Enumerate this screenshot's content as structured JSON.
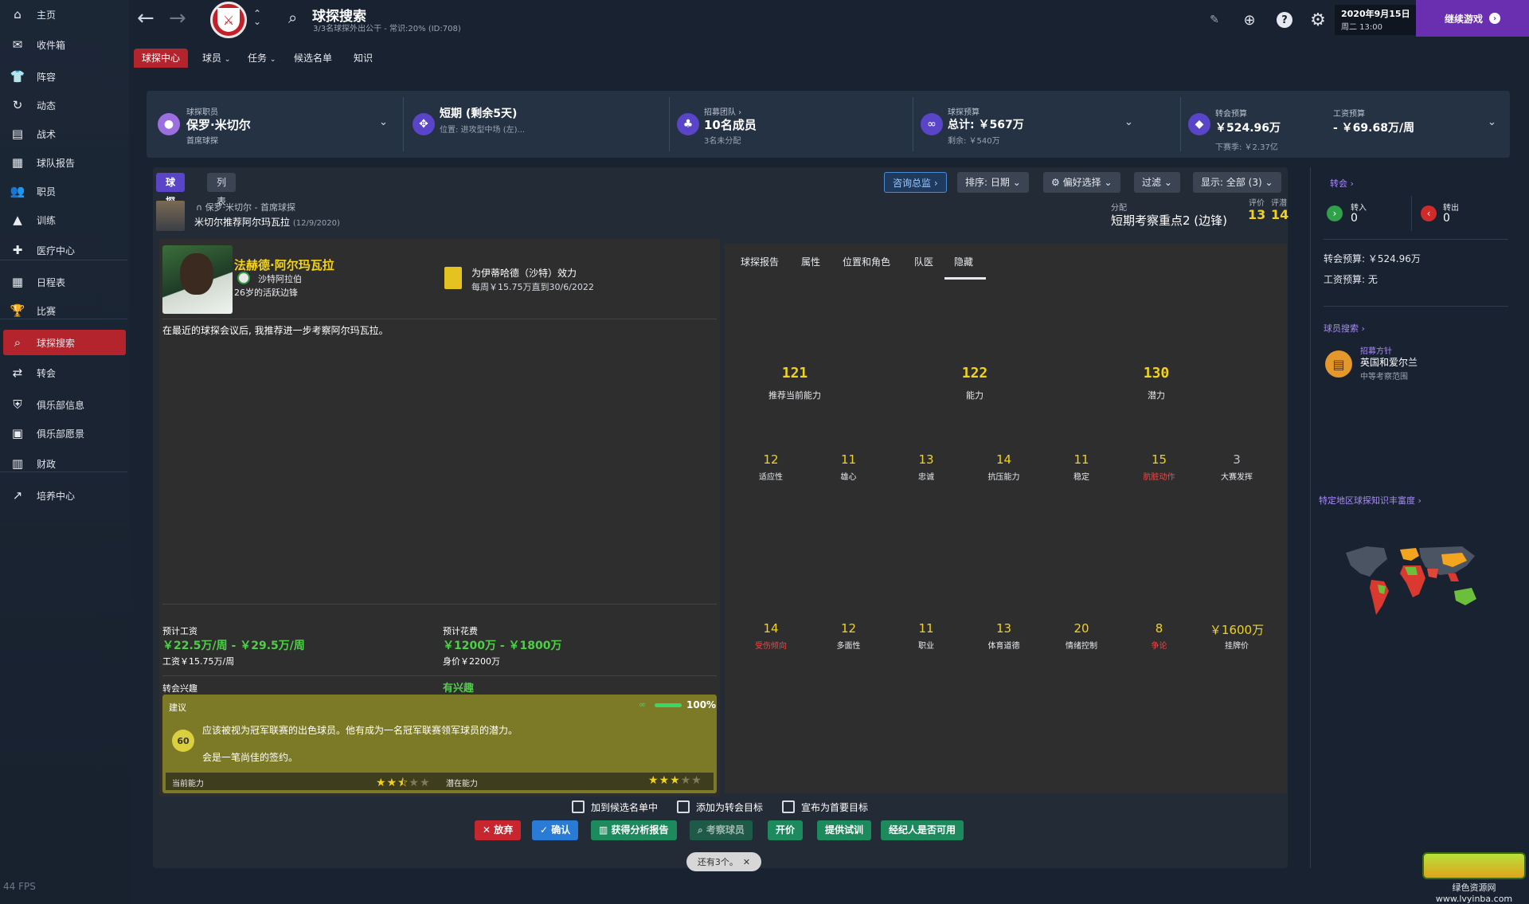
{
  "sidebar": {
    "items": [
      {
        "label": "主页",
        "icon": "home-icon",
        "glyph": "⌂"
      },
      {
        "label": "收件箱",
        "icon": "inbox-icon",
        "glyph": "✉"
      },
      {
        "label": "阵容",
        "icon": "squad-icon",
        "glyph": "👕"
      },
      {
        "label": "动态",
        "icon": "dynamics-icon",
        "glyph": "↻"
      },
      {
        "label": "战术",
        "icon": "tactics-icon",
        "glyph": "▤"
      },
      {
        "label": "球队报告",
        "icon": "team-report-icon",
        "glyph": "▦"
      },
      {
        "label": "职员",
        "icon": "staff-icon",
        "glyph": "👥"
      },
      {
        "label": "训练",
        "icon": "training-icon",
        "glyph": "▲"
      },
      {
        "label": "医疗中心",
        "icon": "medical-icon",
        "glyph": "✚"
      },
      {
        "label": "日程表",
        "icon": "schedule-icon",
        "glyph": "▦"
      },
      {
        "label": "比赛",
        "icon": "trophy-icon",
        "glyph": "🏆"
      },
      {
        "label": "球探搜索",
        "icon": "search-icon",
        "glyph": "⌕"
      },
      {
        "label": "转会",
        "icon": "transfer-icon",
        "glyph": "⇄"
      },
      {
        "label": "俱乐部信息",
        "icon": "shield-icon",
        "glyph": "⛨"
      },
      {
        "label": "俱乐部愿景",
        "icon": "vision-icon",
        "glyph": "▣"
      },
      {
        "label": "财政",
        "icon": "finance-icon",
        "glyph": "▥"
      },
      {
        "label": "培养中心",
        "icon": "development-icon",
        "glyph": "↗"
      }
    ],
    "fps": "44 FPS"
  },
  "topbar": {
    "title": "球探搜索",
    "subtitle": "3/3名球探外出公干 - 常识:20% (ID:708)",
    "date_line1": "2020年9月15日",
    "date_line2": "周二 13:00",
    "continue_label": "继续游戏"
  },
  "subnav": {
    "items": [
      "球探中心",
      "球员",
      "任务",
      "候选名单",
      "知识"
    ]
  },
  "infobar": {
    "scout_staff": {
      "label": "球探职员",
      "value": "保罗·米切尔",
      "sub": "首席球探"
    },
    "assignment": {
      "value": "短期 (剩余5天)",
      "sub": "位置: 进攻型中场 (左)..."
    },
    "recruitment": {
      "label": "招募团队",
      "value": "10名成员",
      "sub": "3名未分配"
    },
    "scout_budget": {
      "label": "球探预算",
      "value": "总计: ￥567万",
      "sub": "剩余: ￥540万"
    },
    "transfer_budget": {
      "label": "转会预算",
      "value": "￥524.96万",
      "sub": "下赛季: ￥2.37亿"
    },
    "wage_budget": {
      "label": "工资预算",
      "value": "- ￥69.68万/周"
    }
  },
  "view": {
    "tab_card": "球探卡",
    "tab_list": "列表",
    "query_btn": "咨询总监",
    "sort_btn": "排序: 日期",
    "pref_btn": "偏好选择",
    "filter_btn": "过滤",
    "display_btn": "显示: 全部 (3)"
  },
  "report": {
    "by": "保罗·米切尔 - 首席球探",
    "title": "米切尔推荐阿尔玛瓦拉",
    "date": "(12/9/2020)",
    "alloc_label": "分配",
    "alloc_value": "短期考察重点2 (边锋)",
    "rating_label1": "评价",
    "rating_label2": "评潜",
    "rating_value1": "13",
    "rating_value2": "14"
  },
  "player": {
    "name": "法赫德·阿尔玛瓦拉",
    "club": "沙特阿拉伯",
    "age_line": "26岁的活跃边锋",
    "contract_line1": "为伊蒂哈德（沙特）效力",
    "contract_line2": "每周￥15.75万直到30/6/2022",
    "summary": "在最近的球探会议后, 我推荐进一步考察阿尔玛瓦拉。",
    "wage_label": "预计工资",
    "wage_value": "￥22.5万/周 - ￥29.5万/周",
    "wage_sub": "工资￥15.75万/周",
    "fee_label": "预计花费",
    "fee_value": "￥1200万 - ￥1800万",
    "fee_sub": "身价￥2200万",
    "interest_label": "转会兴趣",
    "interest_value": "有兴趣",
    "advice_label": "建议",
    "advice_pct": "100%",
    "advice_fill": 1.0,
    "advice_badge": "60",
    "advice_text1": "应该被视为冠军联赛的出色球员。他有成为一名冠军联赛领军球员的潜力。",
    "advice_text2": "会是一笔尚佳的签约。",
    "current_ability_label": "当前能力",
    "potential_ability_label": "潜在能力",
    "current_stars": 2.5,
    "potential_stars": 3
  },
  "right_tabs": [
    "球探报告",
    "属性",
    "位置和角色",
    "队医",
    "隐藏"
  ],
  "hidden": {
    "big": [
      {
        "value": "121",
        "label": "推荐当前能力"
      },
      {
        "value": "122",
        "label": "能力"
      },
      {
        "value": "130",
        "label": "潜力"
      }
    ],
    "row1": [
      {
        "value": "12",
        "label": "适应性",
        "color": "#e6e9ee"
      },
      {
        "value": "11",
        "label": "雄心",
        "color": "#e6e9ee"
      },
      {
        "value": "13",
        "label": "忠诚",
        "color": "#e6e9ee"
      },
      {
        "value": "14",
        "label": "抗压能力",
        "color": "#e6e9ee"
      },
      {
        "value": "11",
        "label": "稳定",
        "color": "#e6e9ee"
      },
      {
        "value": "15",
        "label": "肮脏动作",
        "color": "#e84a4a"
      },
      {
        "value": "3",
        "label": "大赛发挥",
        "color": "#e6e9ee"
      }
    ],
    "row2": [
      {
        "value": "14",
        "label": "受伤倾向",
        "color": "#e84a4a"
      },
      {
        "value": "12",
        "label": "多面性",
        "color": "#e6e9ee"
      },
      {
        "value": "11",
        "label": "职业",
        "color": "#e6e9ee"
      },
      {
        "value": "13",
        "label": "体育道德",
        "color": "#e6e9ee"
      },
      {
        "value": "20",
        "label": "情绪控制",
        "color": "#e6e9ee"
      },
      {
        "value": "8",
        "label": "争论",
        "color": "#e84a4a"
      },
      {
        "value": "￥1600万",
        "label": "挂牌价",
        "color": "#e6e9ee"
      }
    ]
  },
  "actions": {
    "chk_shortlist": "加到候选名单中",
    "chk_target": "添加为转会目标",
    "chk_primary": "宣布为首要目标",
    "btn_discard": "放弃",
    "btn_confirm": "确认",
    "btn_analysis": "获得分析报告",
    "btn_scout": "考察球员",
    "btn_bid": "开价",
    "btn_trial": "提供试训",
    "btn_agent": "经纪人是否可用",
    "more": "还有3个。"
  },
  "rside": {
    "transfer_head": "转会",
    "in_label": "转入",
    "in_value": "0",
    "out_label": "转出",
    "out_value": "0",
    "transfer_budget": "转会预算: ￥524.96万",
    "wage_budget": "工资预算: 无",
    "player_search_head": "球员搜索",
    "policy_label": "招募方针",
    "policy_value": "英国和爱尔兰",
    "policy_sub": "中等考察范围",
    "knowledge_head": "特定地区球探知识丰富度"
  },
  "watermark": "绿色资源网 www.lvyinba.com",
  "colors": {
    "accent": "#b3242c",
    "purple": "#6a2fb1",
    "yellow": "#f2d21b",
    "green": "#4fcf48",
    "red": "#e84a4a"
  }
}
